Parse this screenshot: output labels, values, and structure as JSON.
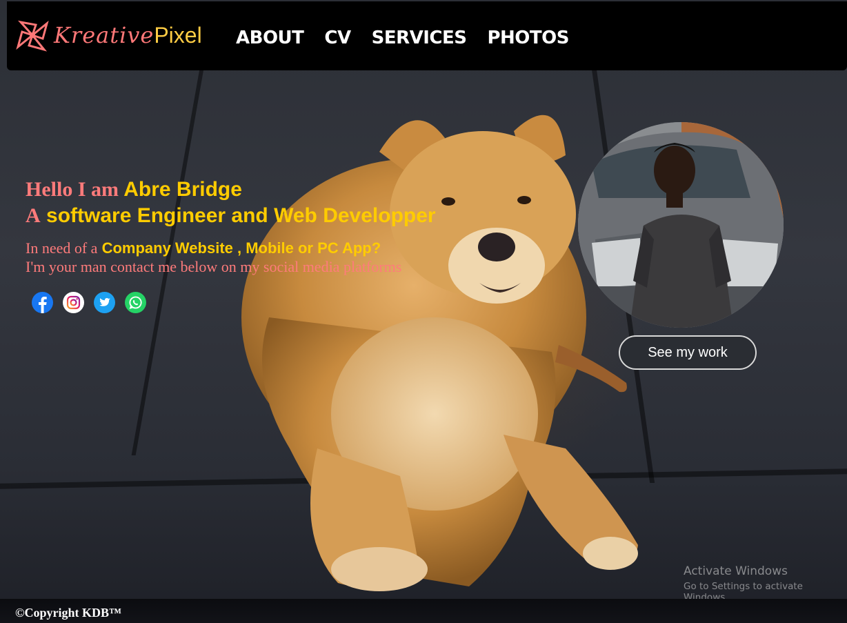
{
  "brand": {
    "name_part1": "Kreative",
    "name_part2": "Pixel",
    "colors": {
      "pink": "#ff7878",
      "gold": "#ffcc44"
    }
  },
  "nav": {
    "items": [
      {
        "label": "ABOUT",
        "icon": ""
      },
      {
        "label": "CV",
        "icon": ""
      },
      {
        "label": "SERVICES",
        "icon": ""
      },
      {
        "label": "PHOTOS",
        "icon": ""
      }
    ]
  },
  "hero": {
    "greeting": "Hello I am",
    "name": "Abre Bridge",
    "role_prefix": "A",
    "role": "software Engineer and Web Developper",
    "need_prefix": "In need of a",
    "need_items": "Company Website , Mobile or PC App?",
    "contact_text": "I'm your man contact me below on my social media platforms",
    "accent_colors": {
      "pink": "#ff7b7b",
      "gold": "#ffcc00"
    }
  },
  "socials": [
    {
      "name": "facebook-icon"
    },
    {
      "name": "instagram-icon"
    },
    {
      "name": "twitter-icon"
    },
    {
      "name": "whatsapp-icon"
    }
  ],
  "cta": {
    "label": "See my work"
  },
  "watermark": {
    "title": "Activate Windows",
    "subtitle": "Go to Settings to activate Windows."
  },
  "footer": {
    "copyright": "©Copyright KDB™"
  }
}
